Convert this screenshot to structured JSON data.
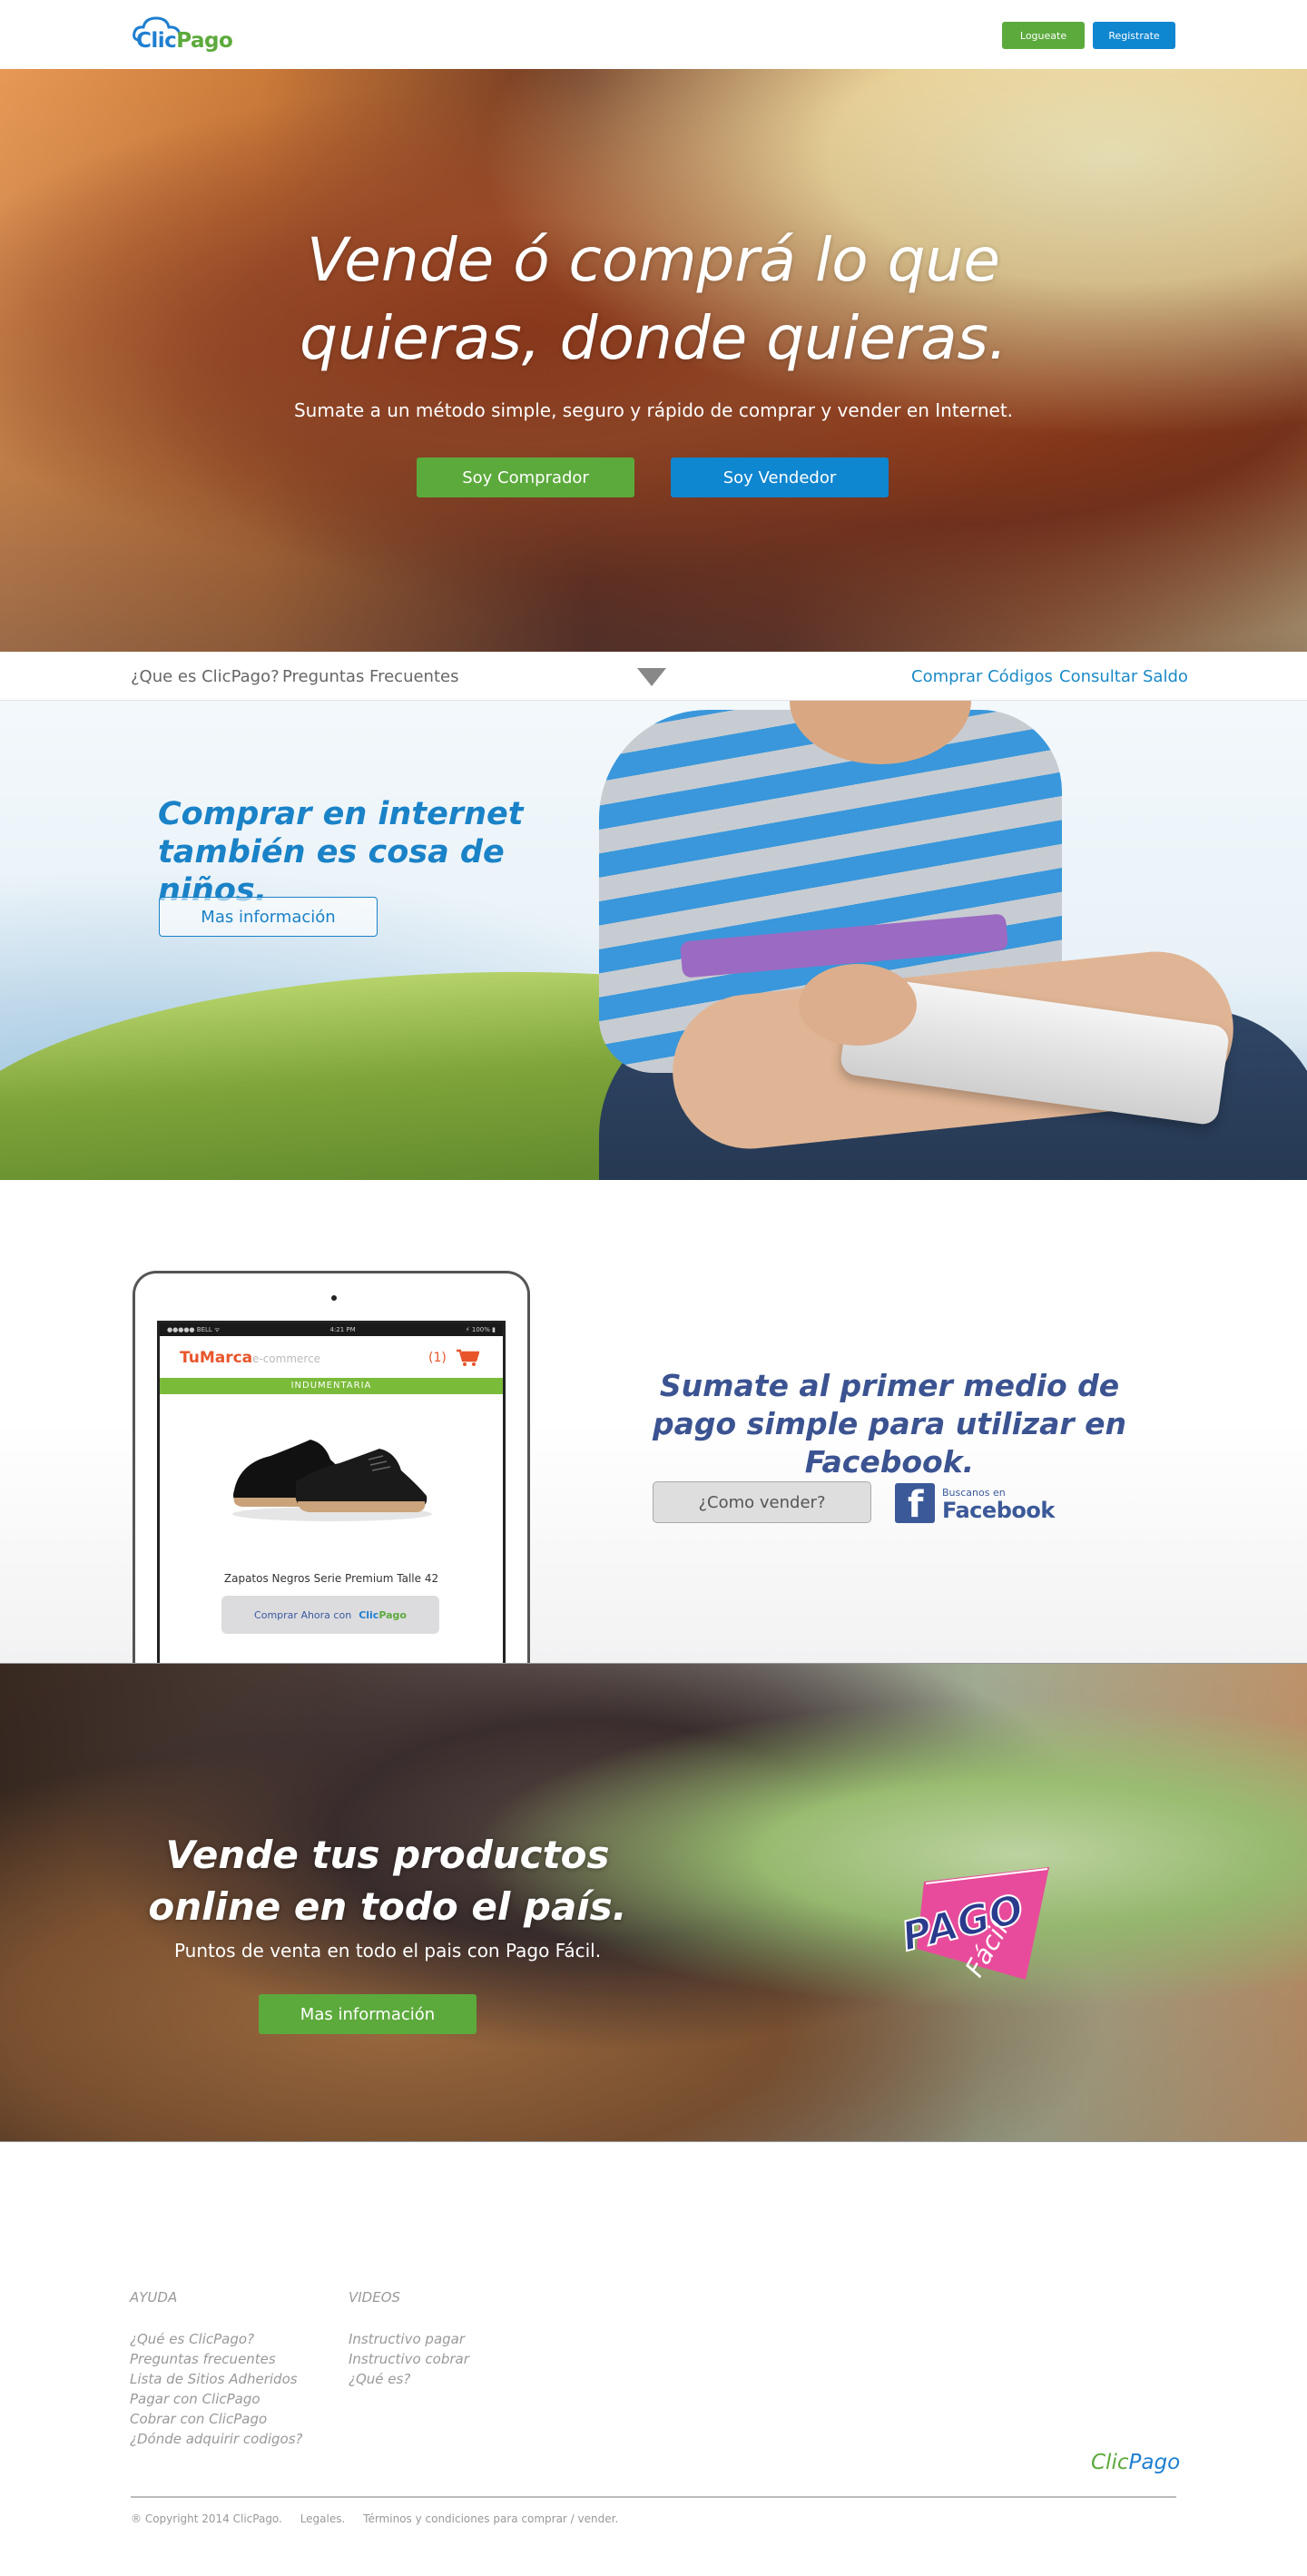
{
  "header": {
    "logo": {
      "part1": "Clic",
      "part2": "Pago"
    },
    "login_label": "Logueate",
    "register_label": "Registrate",
    "colors": {
      "green": "#5caa3c",
      "blue": "#0f86d0"
    }
  },
  "hero": {
    "title": "Vende ó comprá lo que quieras, donde quieras.",
    "subtitle": "Sumate a un método simple, seguro y rápido de comprar y vender en Internet.",
    "buyer_label": "Soy Comprador",
    "seller_label": "Soy Vendedor"
  },
  "subnav": {
    "left": [
      "¿Que es ClicPago?",
      "Preguntas Frecuentes"
    ],
    "right": [
      "Comprar Códigos",
      "Consultar Saldo"
    ],
    "toggle_icon": "triangle-down-icon"
  },
  "kids": {
    "title": "Comprar en internet también es cosa de niños.",
    "button_label": "Mas información"
  },
  "facebook": {
    "tablet": {
      "status_left": "●●●●● BELL ᯤ",
      "status_time": "4:21 PM",
      "status_right": "⚡ 100% ▮",
      "brand": "TuMarca",
      "brand_sub": "e-commerce",
      "cart_count": "(1)",
      "category": "INDUMENTARIA",
      "product_name": "Zapatos Negros Serie Premium Talle 42",
      "buy_label": "Comprar Ahora con",
      "buy_logo": {
        "part1": "Clic",
        "part2": "Pago"
      }
    },
    "title": "Sumate al primer medio de pago simple para utilizar en Facebook.",
    "sell_button": "¿Como vender?",
    "badge_small": "Buscanos en",
    "badge_big": "Facebook"
  },
  "pagofacil": {
    "title": "Vende tus productos online en todo el país.",
    "subtitle": "Puntos de venta en todo el pais con Pago Fácil.",
    "button_label": "Mas información",
    "logo_text": {
      "top": "PAGO",
      "bottom": "Fácil"
    }
  },
  "footer": {
    "col1": {
      "heading": "AYUDA",
      "links": [
        "¿Qué es ClicPago?",
        "Preguntas frecuentes",
        "Lista de Sitios Adheridos",
        "Pagar con ClicPago",
        "Cobrar con ClicPago",
        "¿Dónde adquirir codigos?"
      ]
    },
    "col2": {
      "heading": "VIDEOS",
      "links": [
        "Instructivo pagar",
        "Instructivo cobrar",
        "¿Qué es?"
      ]
    },
    "logo": {
      "part1": "Clic",
      "part2": "Pago"
    },
    "copyright": "® Copyright 2014 ClicPago.",
    "legal": "Legales.",
    "terms": "Términos y condiciones para comprar / vender."
  }
}
